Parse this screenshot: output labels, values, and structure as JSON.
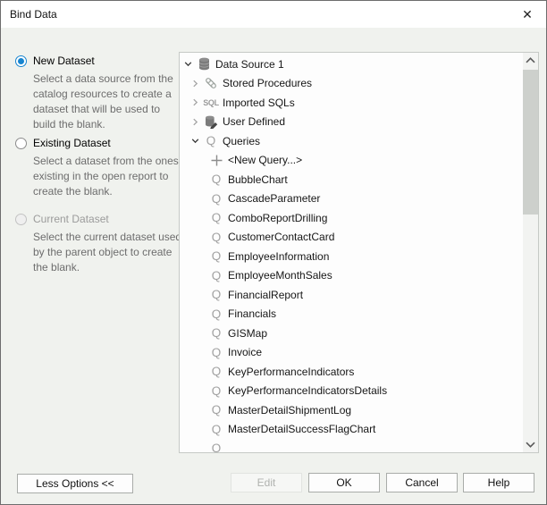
{
  "window": {
    "title": "Bind Data"
  },
  "colors": {
    "accent": "#1784cf",
    "disabled_text": "#b0b2af",
    "description_text": "#6d6d6d"
  },
  "options": {
    "items": [
      {
        "label": "New Dataset",
        "state": "selected",
        "description": "Select a data source from the catalog resources to create a dataset that will be used to build the blank."
      },
      {
        "label": "Existing Dataset",
        "state": "unselected",
        "description": "Select a dataset from the ones existing in the open report to create the blank."
      },
      {
        "label": "Current Dataset",
        "state": "disabled",
        "description": "Select the current dataset used by the parent object to create the blank."
      }
    ]
  },
  "tree": {
    "items": [
      {
        "label": "Data Source 1",
        "level": 0,
        "icon": "database-icon",
        "chevron": "expanded"
      },
      {
        "label": "Stored Procedures",
        "level": 1,
        "icon": "stored-procedure-icon",
        "chevron": "collapsed"
      },
      {
        "label": "Imported SQLs",
        "level": 1,
        "icon": "sql-icon",
        "chevron": "collapsed"
      },
      {
        "label": "User Defined",
        "level": 1,
        "icon": "user-defined-icon",
        "chevron": "collapsed"
      },
      {
        "label": "Queries",
        "level": 1,
        "icon": "query-icon",
        "chevron": "expanded"
      },
      {
        "label": "<New Query...>",
        "level": 2,
        "icon": "plus-icon"
      },
      {
        "label": "BubbleChart",
        "level": 2,
        "icon": "query-icon"
      },
      {
        "label": "CascadeParameter",
        "level": 2,
        "icon": "query-icon"
      },
      {
        "label": "ComboReportDrilling",
        "level": 2,
        "icon": "query-icon"
      },
      {
        "label": "CustomerContactCard",
        "level": 2,
        "icon": "query-icon"
      },
      {
        "label": "EmployeeInformation",
        "level": 2,
        "icon": "query-icon"
      },
      {
        "label": "EmployeeMonthSales",
        "level": 2,
        "icon": "query-icon"
      },
      {
        "label": "FinancialReport",
        "level": 2,
        "icon": "query-icon"
      },
      {
        "label": "Financials",
        "level": 2,
        "icon": "query-icon"
      },
      {
        "label": "GISMap",
        "level": 2,
        "icon": "query-icon"
      },
      {
        "label": "Invoice",
        "level": 2,
        "icon": "query-icon"
      },
      {
        "label": "KeyPerformanceIndicators",
        "level": 2,
        "icon": "query-icon"
      },
      {
        "label": "KeyPerformanceIndicatorsDetails",
        "level": 2,
        "icon": "query-icon"
      },
      {
        "label": "MasterDetailShipmentLog",
        "level": 2,
        "icon": "query-icon"
      },
      {
        "label": "MasterDetailSuccessFlagChart",
        "level": 2,
        "icon": "query-icon"
      },
      {
        "label": "",
        "level": 2,
        "icon": "query-icon"
      }
    ]
  },
  "icons": {
    "close-icon": "✕",
    "sql-icon": "SQL",
    "query-icon": "Q",
    "plus-icon": "+"
  },
  "buttons": {
    "less_options": "Less Options <<",
    "edit": "Edit",
    "ok": "OK",
    "cancel": "Cancel",
    "help": "Help"
  }
}
